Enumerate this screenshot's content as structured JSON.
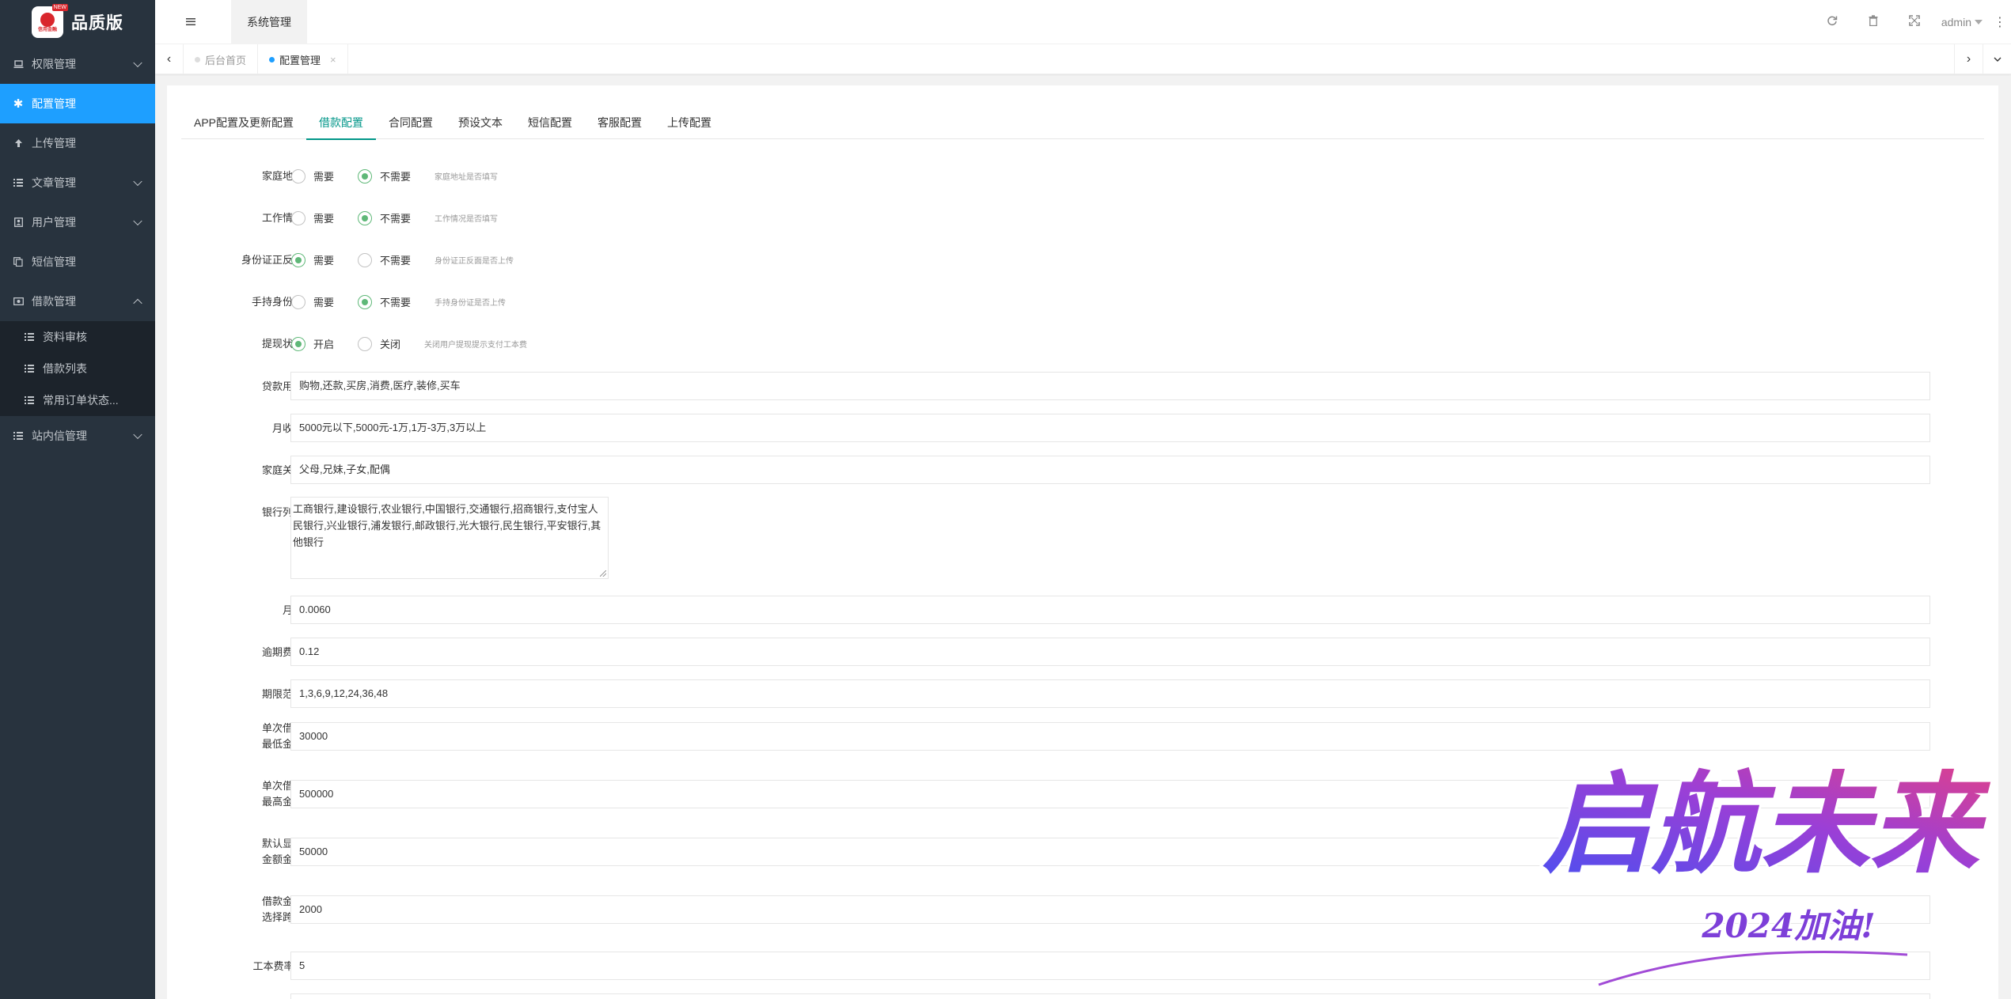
{
  "brand": {
    "name": "品质版",
    "logo_text": "信用金融",
    "logo_tag": "NEW"
  },
  "sidebar": {
    "items": [
      {
        "label": "权限管理",
        "icon": "laptop-icon",
        "expandable": true
      },
      {
        "label": "配置管理",
        "icon": "gear-icon",
        "expandable": false,
        "active": true
      },
      {
        "label": "上传管理",
        "icon": "arrow-up-icon",
        "expandable": false
      },
      {
        "label": "文章管理",
        "icon": "list-icon",
        "expandable": true
      },
      {
        "label": "用户管理",
        "icon": "user-icon",
        "expandable": true
      },
      {
        "label": "短信管理",
        "icon": "copy-icon",
        "expandable": false
      },
      {
        "label": "借款管理",
        "icon": "money-icon",
        "expandable": true,
        "expanded": true
      },
      {
        "label": "站内信管理",
        "icon": "list-icon",
        "expandable": true
      }
    ],
    "loan_children": [
      {
        "label": "资料审核"
      },
      {
        "label": "借款列表"
      },
      {
        "label": "常用订单状态..."
      }
    ]
  },
  "topbar": {
    "current_tab": "系统管理",
    "user": "admin",
    "icons": [
      "refresh-icon",
      "trash-icon",
      "fullscreen-icon",
      "more-icon"
    ]
  },
  "pagetabs": [
    {
      "label": "后台首页",
      "active": false
    },
    {
      "label": "配置管理",
      "active": true,
      "close": "×"
    }
  ],
  "config_tabs": [
    {
      "label": "APP配置及更新配置",
      "active": false
    },
    {
      "label": "借款配置",
      "active": true
    },
    {
      "label": "合同配置",
      "active": false
    },
    {
      "label": "预设文本",
      "active": false
    },
    {
      "label": "短信配置",
      "active": false
    },
    {
      "label": "客服配置",
      "active": false
    },
    {
      "label": "上传配置",
      "active": false
    }
  ],
  "radio_rows": [
    {
      "label": "家庭地址",
      "opt1": "需要",
      "opt2": "不需要",
      "selected": 2,
      "hint": "家庭地址是否填写"
    },
    {
      "label": "工作情况",
      "opt1": "需要",
      "opt2": "不需要",
      "selected": 2,
      "hint": "工作情况是否填写"
    },
    {
      "label": "身份证正反面",
      "opt1": "需要",
      "opt2": "不需要",
      "selected": 1,
      "hint": "身份证正反面是否上传"
    },
    {
      "label": "手持身份证",
      "opt1": "需要",
      "opt2": "不需要",
      "selected": 2,
      "hint": "手持身份证是否上传"
    },
    {
      "label": "提现状态",
      "opt1": "开启",
      "opt2": "关闭",
      "selected": 1,
      "hint": "关闭用户提现提示支付工本费"
    }
  ],
  "fields": {
    "loan_purpose": {
      "label": "贷款用途",
      "value": "购物,还款,买房,消费,医疗,装修,买车"
    },
    "monthly_income": {
      "label": "月收入",
      "value": "5000元以下,5000元-1万,1万-3万,3万以上"
    },
    "family": {
      "label": "家庭关系",
      "value": "父母,兄妹,子女,配偶"
    },
    "bank_list": {
      "label": "银行列表",
      "value": "工商银行,建设银行,农业银行,中国银行,交通银行,招商银行,支付宝人民银行,兴业银行,浦发银行,邮政银行,光大银行,民生银行,平安银行,其他银行"
    },
    "monthly_rate": {
      "label": "月息",
      "value": "0.0060"
    },
    "overdue_rate": {
      "label": "逾期费率",
      "value": "0.12"
    },
    "term_range": {
      "label": "期限范围",
      "value": "1,3,6,9,12,24,36,48"
    },
    "min_amount": {
      "label": "单次借款最低金额",
      "value": "30000"
    },
    "max_amount": {
      "label": "单次借款最高金额",
      "value": "500000"
    },
    "default_amount": {
      "label": "默认显示金额金额",
      "value": "50000"
    },
    "step": {
      "label": "借款金额选择跨度",
      "value": "2000"
    },
    "fee_rate": {
      "label": "工本费率%",
      "value": "5"
    }
  },
  "watermark": {
    "main": "启航未来",
    "sub": "2024加油!"
  }
}
